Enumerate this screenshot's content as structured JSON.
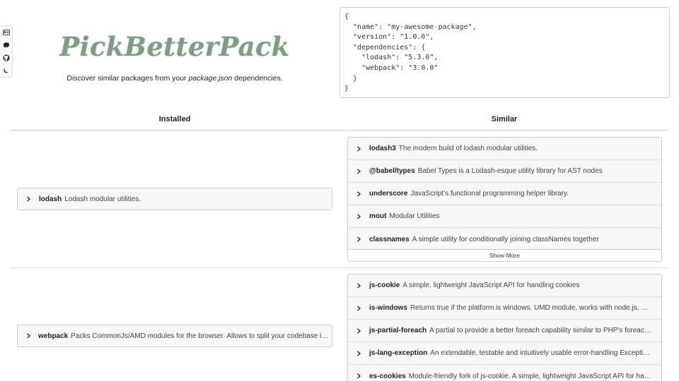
{
  "toolbar": {
    "items": [
      {
        "icon": "id-card-icon"
      },
      {
        "icon": "chat-icon"
      },
      {
        "icon": "github-icon"
      },
      {
        "icon": "moon-icon"
      }
    ]
  },
  "hero": {
    "logo": "PickBetterPack",
    "tagline_before": "Discover similar packages from your ",
    "tagline_em": "package.json",
    "tagline_after": " dependencies."
  },
  "json_input": {
    "value": "{\n  \"name\": \"my-awesome-package\",\n  \"version\": \"1.0.0\",\n  \"dependencies\": {\n    \"lodash\": \"5.3.0\",\n    \"webpack\": \"3.0.0\"\n  }\n}"
  },
  "columns": {
    "installed": "Installed",
    "similar": "Similar"
  },
  "rows": [
    {
      "installed": {
        "name": "lodash",
        "desc": "Lodash modular utilities."
      },
      "similar": [
        {
          "name": "lodash3",
          "desc": "The modern build of lodash modular utilities."
        },
        {
          "name": "@babel/types",
          "desc": "Babel Types is a Lodash-esque utility library for AST nodes"
        },
        {
          "name": "underscore",
          "desc": "JavaScript's functional programming helper library."
        },
        {
          "name": "mout",
          "desc": "Modular Utilities"
        },
        {
          "name": "classnames",
          "desc": "A simple utility for conditionally joining classNames together"
        }
      ],
      "show_more": "Show More"
    },
    {
      "installed": {
        "name": "webpack",
        "desc": "Packs CommonJs/AMD modules for the browser. Allows to split your codebase into multiple bundles, which can be loaded on demand."
      },
      "similar": [
        {
          "name": "js-cookie",
          "desc": "A simple, lightweight JavaScript API for handling cookies"
        },
        {
          "name": "is-windows",
          "desc": "Returns true if the platform is windows. UMD module, works with node.js, commonjs, browser, AMD, electron, etc."
        },
        {
          "name": "js-partial-foreach",
          "desc": "A partial to provide a better foreach capability similar to PHP's foreach construct"
        },
        {
          "name": "js-lang-exception",
          "desc": "An extendable, testable and intuitively usable error-handling Exception class"
        },
        {
          "name": "es-cookies",
          "desc": "Module-friendly fork of js-cookie. A simple, lightweight JavaScript API for handling cookies"
        }
      ]
    }
  ]
}
